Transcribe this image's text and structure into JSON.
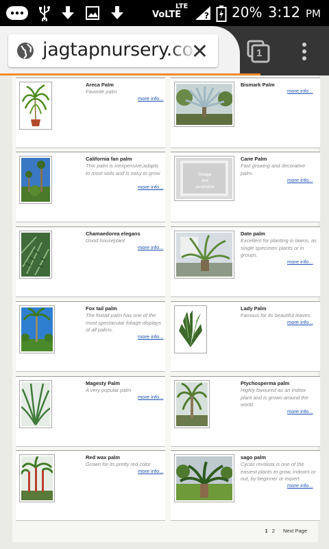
{
  "status_bar": {
    "network": "VoLTE",
    "lte": "LTE",
    "battery": "20%",
    "time": "3:12",
    "ampm": "PM"
  },
  "browser": {
    "url": "jagtapnursery.com",
    "tab_count": "1"
  },
  "products": [
    {
      "name": "Areca Palm",
      "desc": "Favorite palm",
      "more": "more info..."
    },
    {
      "name": "Bismark Palm",
      "desc": "",
      "more": "more info..."
    },
    {
      "name": "California fan palm",
      "desc": "This palm is inexpensive,adapts to most soils and is easy to grow",
      "more": "more info..."
    },
    {
      "name": "Cane Palm",
      "desc": "Fast growing and decorative palm.",
      "more": "more info..."
    },
    {
      "name": "Chamaedorea elegans",
      "desc": "Good houseplant",
      "more": "more info..."
    },
    {
      "name": "Date palm",
      "desc": "Excellent for planting in lawns, as single specimen plants or in groups.",
      "more": "more info..."
    },
    {
      "name": "Fox tail palm",
      "desc": "The foxtail palm has one of the most spectacular foliage displays of all palms.",
      "more": "more info..."
    },
    {
      "name": "Lady Palm",
      "desc": "Famous for its beautiful leaves",
      "more": "more info..."
    },
    {
      "name": "Magesty Palm",
      "desc": "A very popular palm",
      "more": "more info..."
    },
    {
      "name": "Ptychosperma palm",
      "desc": "Highly favoured as an indoor plant and is grown around the world.",
      "more": "more info..."
    },
    {
      "name": "Red wax palm",
      "desc": "Grown for its pretty red color",
      "more": "more info..."
    },
    {
      "name": "sago palm",
      "desc": "Cycas revoluta is one of the easiest plants to grow, indoors or out, by beginner or expert.",
      "more": "more info..."
    }
  ],
  "placeholder_image_text": "Image not available",
  "pagination": {
    "pages": [
      "1",
      "2"
    ],
    "next": "Next Page"
  }
}
